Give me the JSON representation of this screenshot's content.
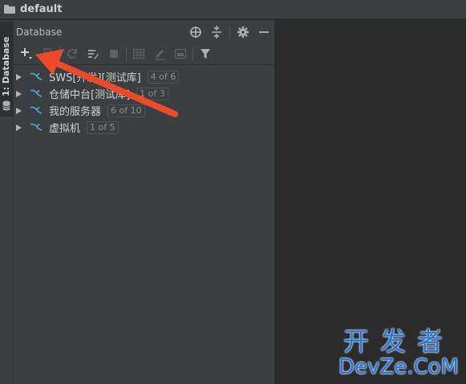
{
  "window": {
    "title": "default"
  },
  "left_tab": {
    "label": "1: Database"
  },
  "panel": {
    "title": "Database",
    "header_icons": [
      "crosshair-icon",
      "collapse-icon",
      "gear-icon",
      "minimize-icon"
    ],
    "toolbar_icons": [
      "add-icon",
      "copy-icon",
      "refresh-icon",
      "properties-icon",
      "stop-icon",
      "table-icon",
      "edit-icon",
      "console-icon",
      "filter-icon"
    ]
  },
  "tree": {
    "items": [
      {
        "label": "SWS[开发][测试库]",
        "badge": "4 of 6"
      },
      {
        "label": "仓储中台[测试库]",
        "badge": "1 of 3"
      },
      {
        "label": "我的服务器",
        "badge": "6 of 10"
      },
      {
        "label": "虚拟机",
        "badge": "1 of 5"
      }
    ]
  },
  "watermark": {
    "chinese": "开发者",
    "english": "DevZe.CoM"
  },
  "colors": {
    "panel_bg": "#3c3f41",
    "editor_bg": "#2b2b2b",
    "arrow": "#ee4a2a",
    "dolphin": "#4fa8d6",
    "watermark": "#1f76e6"
  }
}
